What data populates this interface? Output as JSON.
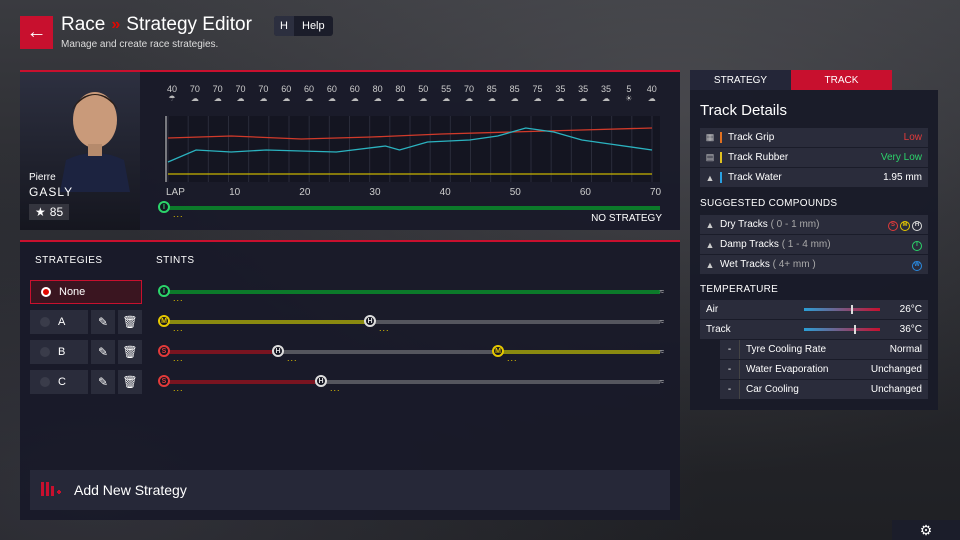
{
  "header": {
    "back_icon": "arrow-left-icon",
    "crumb_race": "Race",
    "crumb_sep": "»",
    "crumb_page": "Strategy Editor",
    "subtitle": "Manage and create race strategies.",
    "help_key": "H",
    "help_label": "Help"
  },
  "driver": {
    "first_name": "Pierre",
    "last_name": "GASLY",
    "rating": "85"
  },
  "weather": {
    "temps": [
      "40",
      "70",
      "70",
      "70",
      "70",
      "60",
      "60",
      "60",
      "60",
      "80",
      "80",
      "50",
      "55",
      "70",
      "85",
      "85",
      "75",
      "35",
      "35",
      "35",
      "5",
      "40"
    ],
    "icons": [
      "rain-icon",
      "cloud-icon",
      "cloud-icon",
      "cloud-icon",
      "cloud-icon",
      "cloud-icon",
      "cloud-icon",
      "cloud-icon",
      "cloud-icon",
      "cloud-icon",
      "cloud-icon",
      "cloud-icon",
      "cloud-icon",
      "cloud-icon",
      "cloud-icon",
      "cloud-icon",
      "cloud-icon",
      "cloud-icon",
      "cloud-icon",
      "cloud-icon",
      "sun-icon",
      "cloud-icon"
    ]
  },
  "chart_data": {
    "type": "line",
    "xlabel": "LAP",
    "x_ticks": [
      "10",
      "20",
      "30",
      "40",
      "50",
      "60",
      "70"
    ],
    "xlim": [
      1,
      70
    ],
    "series": [
      {
        "color": "#d13a2a",
        "values": [
          [
            1,
            42
          ],
          [
            10,
            44
          ],
          [
            20,
            41
          ],
          [
            30,
            43
          ],
          [
            40,
            46
          ],
          [
            50,
            48
          ],
          [
            60,
            50
          ],
          [
            70,
            52
          ]
        ]
      },
      {
        "color": "#2bb3c0",
        "values": [
          [
            1,
            18
          ],
          [
            5,
            30
          ],
          [
            10,
            28
          ],
          [
            15,
            30
          ],
          [
            25,
            28
          ],
          [
            32,
            34
          ],
          [
            34,
            30
          ],
          [
            38,
            38
          ],
          [
            44,
            40
          ],
          [
            48,
            44
          ],
          [
            52,
            52
          ],
          [
            56,
            48
          ],
          [
            60,
            40
          ],
          [
            64,
            36
          ],
          [
            70,
            30
          ]
        ]
      },
      {
        "color": "#c8b400",
        "values": [
          [
            1,
            6
          ],
          [
            70,
            6
          ]
        ]
      }
    ]
  },
  "strategy_bar": {
    "no_strategy": "NO STRATEGY"
  },
  "strategies": {
    "header": "STRATEGIES",
    "stints_header": "STINTS",
    "items": [
      {
        "label": "None"
      },
      {
        "label": "A"
      },
      {
        "label": "B"
      },
      {
        "label": "C"
      }
    ],
    "edit_icon": "pencil-icon",
    "delete_icon": "trash-icon"
  },
  "add_new": {
    "label": "Add New Strategy",
    "icon": "add-strategy-icon"
  },
  "tabs": {
    "strategy": "STRATEGY",
    "track": "TRACK"
  },
  "track": {
    "title": "Track Details",
    "rows": [
      {
        "label": "Track Grip",
        "value": "Low",
        "color": "#e03a3a",
        "bar": "#e07020"
      },
      {
        "label": "Track Rubber",
        "value": "Very Low",
        "color": "#2bd46a",
        "bar": "#e0c020"
      },
      {
        "label": "Track Water",
        "value": "1.95 mm",
        "color": "#ffffff",
        "bar": "#2aa0e0"
      }
    ],
    "compounds_title": "SUGGESTED COMPOUNDS",
    "compounds": [
      {
        "label": "Dry Tracks",
        "range": "( 0 - 1 mm)"
      },
      {
        "label": "Damp Tracks",
        "range": "( 1 - 4 mm)"
      },
      {
        "label": "Wet Tracks",
        "range": "( 4+ mm )"
      }
    ],
    "temperature_title": "TEMPERATURE",
    "air": {
      "label": "Air",
      "value": "26°C",
      "level": 0.62
    },
    "trackt": {
      "label": "Track",
      "value": "36°C",
      "level": 0.66
    },
    "settings": [
      {
        "label": "Tyre Cooling Rate",
        "value": "Normal"
      },
      {
        "label": "Water Evaporation",
        "value": "Unchanged"
      },
      {
        "label": "Car Cooling",
        "value": "Unchanged"
      }
    ]
  }
}
